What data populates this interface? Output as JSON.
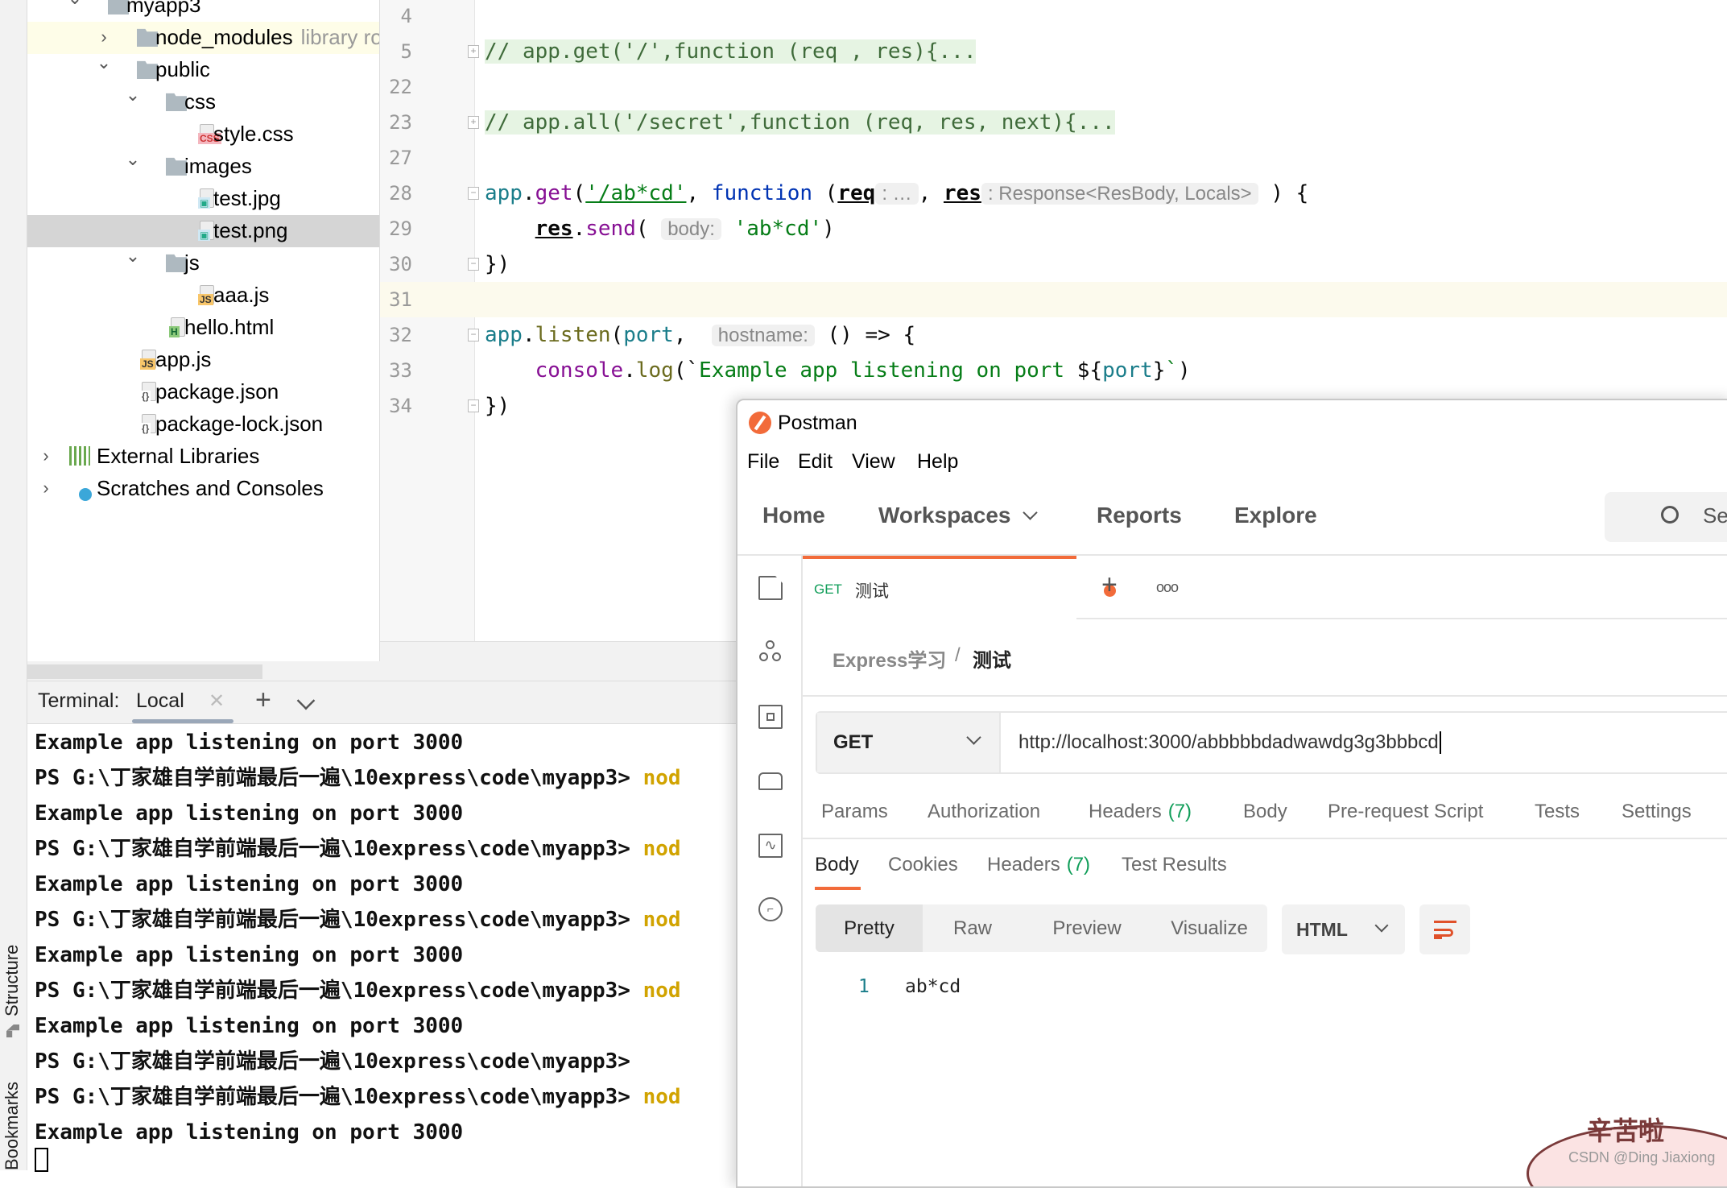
{
  "left_strip": {
    "structure": "Structure",
    "bookmarks": "Bookmarks"
  },
  "project_tree": [
    {
      "label": "myapp3",
      "level": 0,
      "kind": "folder",
      "open": true
    },
    {
      "label": "node_modules",
      "hint": "library root",
      "level": 1,
      "kind": "folder",
      "open": false,
      "highlight": true
    },
    {
      "label": "public",
      "level": 1,
      "kind": "folder",
      "open": true
    },
    {
      "label": "css",
      "level": 2,
      "kind": "folder",
      "open": true
    },
    {
      "label": "style.css",
      "level": 3,
      "kind": "css"
    },
    {
      "label": "images",
      "level": 2,
      "kind": "folder",
      "open": true
    },
    {
      "label": "test.jpg",
      "level": 3,
      "kind": "image"
    },
    {
      "label": "test.png",
      "level": 3,
      "kind": "image",
      "selected": true
    },
    {
      "label": "js",
      "level": 2,
      "kind": "folder",
      "open": true
    },
    {
      "label": "aaa.js",
      "level": 3,
      "kind": "js"
    },
    {
      "label": "hello.html",
      "level": 2,
      "kind": "html"
    },
    {
      "label": "app.js",
      "level": 1,
      "kind": "js"
    },
    {
      "label": "package.json",
      "level": 1,
      "kind": "json"
    },
    {
      "label": "package-lock.json",
      "level": 1,
      "kind": "json"
    },
    {
      "label": "External Libraries",
      "level": -1,
      "kind": "libs",
      "open": false
    },
    {
      "label": "Scratches and Consoles",
      "level": -1,
      "kind": "scratch",
      "open": false
    }
  ],
  "editor": {
    "lines": [
      {
        "num": "4",
        "tokens": []
      },
      {
        "num": "5",
        "folded": true,
        "tokens": [
          {
            "t": "// app.get('/',function (req , res){...",
            "c": "fold"
          }
        ]
      },
      {
        "num": "22",
        "tokens": []
      },
      {
        "num": "23",
        "folded": true,
        "tokens": [
          {
            "t": "// app.all('/secret',function (req, res, next){...",
            "c": "fold"
          }
        ]
      },
      {
        "num": "27",
        "tokens": []
      },
      {
        "num": "28",
        "tokens": [
          {
            "t": "app",
            "c": "t-app"
          },
          {
            "t": ".",
            "c": ""
          },
          {
            "t": "get",
            "c": "t-fn"
          },
          {
            "t": "(",
            "c": ""
          },
          {
            "t": "'/ab*cd'",
            "c": "t-strul"
          },
          {
            "t": ", ",
            "c": ""
          },
          {
            "t": "function",
            "c": "t-kw"
          },
          {
            "t": " (",
            "c": ""
          },
          {
            "t": "req",
            "c": "t-ul"
          },
          {
            "t": ": …",
            "c": "hintbox"
          },
          {
            "t": ", ",
            "c": ""
          },
          {
            "t": "res",
            "c": "t-ul"
          },
          {
            "t": ": Response<ResBody, Locals>",
            "c": "hintbox"
          },
          {
            "t": " ) {",
            "c": ""
          }
        ]
      },
      {
        "num": "29",
        "tokens": [
          {
            "t": "    ",
            "c": ""
          },
          {
            "t": "res",
            "c": "t-ul"
          },
          {
            "t": ".",
            "c": ""
          },
          {
            "t": "send",
            "c": "t-fn"
          },
          {
            "t": "( ",
            "c": ""
          },
          {
            "t": "body:",
            "c": "hintbox"
          },
          {
            "t": " ",
            "c": ""
          },
          {
            "t": "'ab*cd'",
            "c": "t-str"
          },
          {
            "t": ")",
            "c": ""
          }
        ]
      },
      {
        "num": "30",
        "tokens": [
          {
            "t": "})",
            "c": ""
          }
        ]
      },
      {
        "num": "31",
        "current": true,
        "tokens": []
      },
      {
        "num": "32",
        "tokens": [
          {
            "t": "app",
            "c": "t-app"
          },
          {
            "t": ".",
            "c": ""
          },
          {
            "t": "listen",
            "c": "t-ol"
          },
          {
            "t": "(",
            "c": ""
          },
          {
            "t": "port",
            "c": "t-app"
          },
          {
            "t": ",  ",
            "c": ""
          },
          {
            "t": "hostname:",
            "c": "hintbox"
          },
          {
            "t": " () => {",
            "c": ""
          }
        ]
      },
      {
        "num": "33",
        "tokens": [
          {
            "t": "    ",
            "c": ""
          },
          {
            "t": "console",
            "c": "t-fn"
          },
          {
            "t": ".",
            "c": ""
          },
          {
            "t": "log",
            "c": "t-ol"
          },
          {
            "t": "(`",
            "c": ""
          },
          {
            "t": "Example app listening on port ",
            "c": "t-str"
          },
          {
            "t": "${",
            "c": ""
          },
          {
            "t": "port",
            "c": "t-app"
          },
          {
            "t": "}",
            "c": ""
          },
          {
            "t": "`",
            "c": "t-str"
          },
          {
            "t": ")",
            "c": ""
          }
        ]
      },
      {
        "num": "34",
        "tokens": [
          {
            "t": "})",
            "c": ""
          }
        ]
      }
    ]
  },
  "terminal": {
    "title": "Terminal:",
    "tab": "Local",
    "lines": [
      {
        "text": "Example app listening on port 3000"
      },
      {
        "text": "PS G:\\丁家雄自学前端最后一遍\\10express\\code\\myapp3> ",
        "cmd": "nod"
      },
      {
        "text": "Example app listening on port 3000"
      },
      {
        "text": "PS G:\\丁家雄自学前端最后一遍\\10express\\code\\myapp3> ",
        "cmd": "nod"
      },
      {
        "text": "Example app listening on port 3000"
      },
      {
        "text": "PS G:\\丁家雄自学前端最后一遍\\10express\\code\\myapp3> ",
        "cmd": "nod"
      },
      {
        "text": "Example app listening on port 3000"
      },
      {
        "text": "PS G:\\丁家雄自学前端最后一遍\\10express\\code\\myapp3> ",
        "cmd": "nod"
      },
      {
        "text": "Example app listening on port 3000"
      },
      {
        "text": "PS G:\\丁家雄自学前端最后一遍\\10express\\code\\myapp3>"
      },
      {
        "text": "PS G:\\丁家雄自学前端最后一遍\\10express\\code\\myapp3> ",
        "cmd": "nod"
      },
      {
        "text": "Example app listening on port 3000"
      }
    ]
  },
  "postman": {
    "title": "Postman",
    "menu": [
      "File",
      "Edit",
      "View",
      "Help"
    ],
    "nav": {
      "home": "Home",
      "workspaces": "Workspaces",
      "reports": "Reports",
      "explore": "Explore",
      "search": "Se"
    },
    "sidebar_icons": [
      "collections-icon",
      "apis-icon",
      "environments-icon",
      "mock-servers-icon",
      "monitors-icon",
      "history-icon"
    ],
    "tab": {
      "method": "GET",
      "name": "测试",
      "unsaved": true
    },
    "breadcrumb": {
      "collection": "Express学习",
      "sep": "/",
      "request": "测试"
    },
    "request": {
      "method": "GET",
      "url": "http://localhost:3000/abbbbbdadwawdg3g3bbbcd"
    },
    "request_tabs": [
      {
        "label": "Params"
      },
      {
        "label": "Authorization"
      },
      {
        "label": "Headers",
        "count": "(7)"
      },
      {
        "label": "Body"
      },
      {
        "label": "Pre-request Script"
      },
      {
        "label": "Tests"
      },
      {
        "label": "Settings"
      }
    ],
    "response_tabs": [
      {
        "label": "Body",
        "active": true
      },
      {
        "label": "Cookies"
      },
      {
        "label": "Headers",
        "count": "(7)"
      },
      {
        "label": "Test Results"
      }
    ],
    "view_modes": [
      "Pretty",
      "Raw",
      "Preview",
      "Visualize"
    ],
    "active_view": "Pretty",
    "format": "HTML",
    "response_body": [
      {
        "num": "1",
        "text": "ab*cd"
      }
    ],
    "accent": "#f26b3a"
  },
  "watermark": {
    "sticker": "辛苦啦",
    "credit": "CSDN @Ding Jiaxiong"
  }
}
